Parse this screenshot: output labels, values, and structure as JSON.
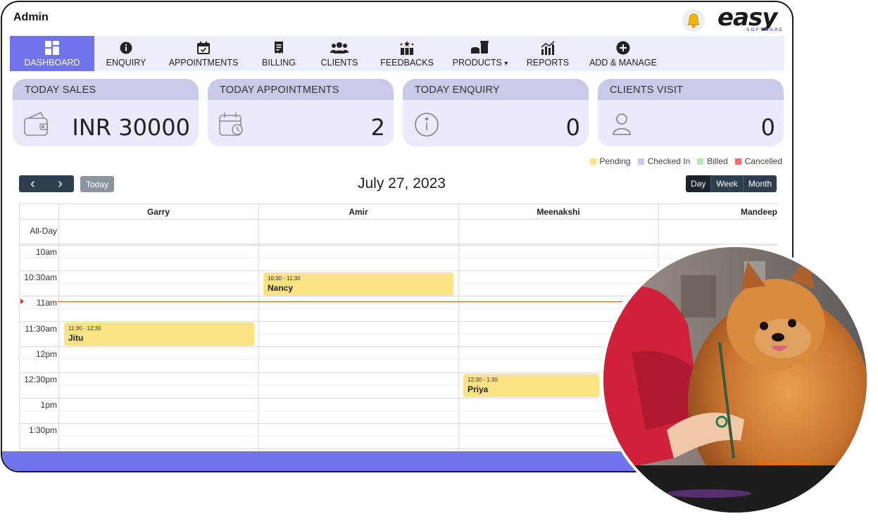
{
  "app": {
    "title": "Admin"
  },
  "logo": {
    "word": "easy",
    "sub": "SOFTWARE"
  },
  "nav": [
    {
      "label": "DASHBOARD",
      "icon": "dashboard-icon",
      "active": true
    },
    {
      "label": "ENQUIRY",
      "icon": "info-icon"
    },
    {
      "label": "APPOINTMENTS",
      "icon": "calendar-check-icon"
    },
    {
      "label": "BILLING",
      "icon": "receipt-icon"
    },
    {
      "label": "CLIENTS",
      "icon": "users-icon"
    },
    {
      "label": "FEEDBACKS",
      "icon": "feedback-icon"
    },
    {
      "label": "PRODUCTS",
      "icon": "products-icon",
      "caret": "▾"
    },
    {
      "label": "REPORTS",
      "icon": "chart-icon"
    },
    {
      "label": "ADD & MANAGE",
      "icon": "plus-circle-icon"
    }
  ],
  "cards": [
    {
      "title": "TODAY SALES",
      "value": "INR 30000",
      "icon": "wallet-icon"
    },
    {
      "title": "TODAY APPOINTMENTS",
      "value": "2",
      "icon": "calendar-clock-icon"
    },
    {
      "title": "TODAY ENQUIRY",
      "value": "0",
      "icon": "info-circle-icon"
    },
    {
      "title": "CLIENTS VISIT",
      "value": "0",
      "icon": "user-icon"
    }
  ],
  "legend": [
    {
      "label": "Pending",
      "color": "#fde383"
    },
    {
      "label": "Checked In",
      "color": "#c9c8f4"
    },
    {
      "label": "Billed",
      "color": "#b8e8b8"
    },
    {
      "label": "Cancelled",
      "color": "#f07070"
    }
  ],
  "calendar": {
    "today_label": "Today",
    "prev_glyph": "‹",
    "next_glyph": "›",
    "date": "July 27, 2023",
    "views": [
      "Day",
      "Week",
      "Month"
    ],
    "active_view": "Day",
    "all_day_label": "All-Day",
    "staff": [
      "Garry",
      "Amir",
      "Meenakshi",
      "Mandeep"
    ],
    "times": [
      "10am",
      "10:30am",
      "11am",
      "11:30am",
      "12pm",
      "12:30pm",
      "1pm",
      "1:30pm"
    ],
    "events": [
      {
        "time": "10:30 - 11:30",
        "name": "Nancy",
        "staff": "Amir"
      },
      {
        "time": "11:30 - 12:30",
        "name": "Jitu",
        "staff": "Garry"
      },
      {
        "time": "12:30 - 1:30",
        "name": "Priya",
        "staff": "Meenakshi"
      }
    ]
  },
  "colors": {
    "accent": "#7173ea",
    "card_bg": "#e9eafb",
    "card_head": "#c9cae8",
    "event": "#fde383"
  }
}
